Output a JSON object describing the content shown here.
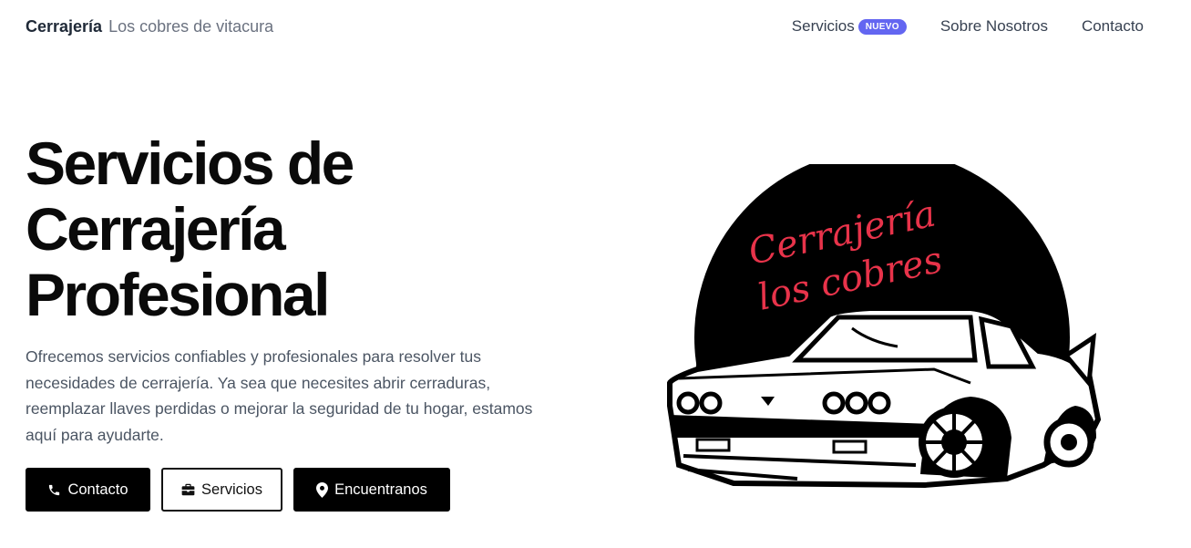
{
  "brand": {
    "name": "Cerrajería",
    "subtitle": "Los cobres de vitacura"
  },
  "nav": {
    "services": {
      "label": "Servicios",
      "badge": "NUEVO"
    },
    "about": {
      "label": "Sobre Nosotros"
    },
    "contact": {
      "label": "Contacto"
    }
  },
  "hero": {
    "title_line1": "Servicios de",
    "title_line2": "Cerrajería",
    "title_line3": "Profesional",
    "description": "Ofrecemos servicios confiables y profesionales para resolver tus necesidades de cerrajería. Ya sea que necesites abrir cerraduras, reemplazar llaves perdidas o mejorar la seguridad de tu hogar, estamos aquí para ayudarte."
  },
  "buttons": {
    "contact": {
      "label": "Contacto",
      "icon": "phone-icon"
    },
    "services": {
      "label": "Servicios",
      "icon": "briefcase-icon"
    },
    "locate": {
      "label": "Encuentranos",
      "icon": "map-pin-icon"
    }
  },
  "logo": {
    "line1": "Cerrajería",
    "line2": "los cobres"
  },
  "colors": {
    "badge": "#6366f1",
    "logo_text": "#e8334a",
    "dark": "#000000"
  }
}
